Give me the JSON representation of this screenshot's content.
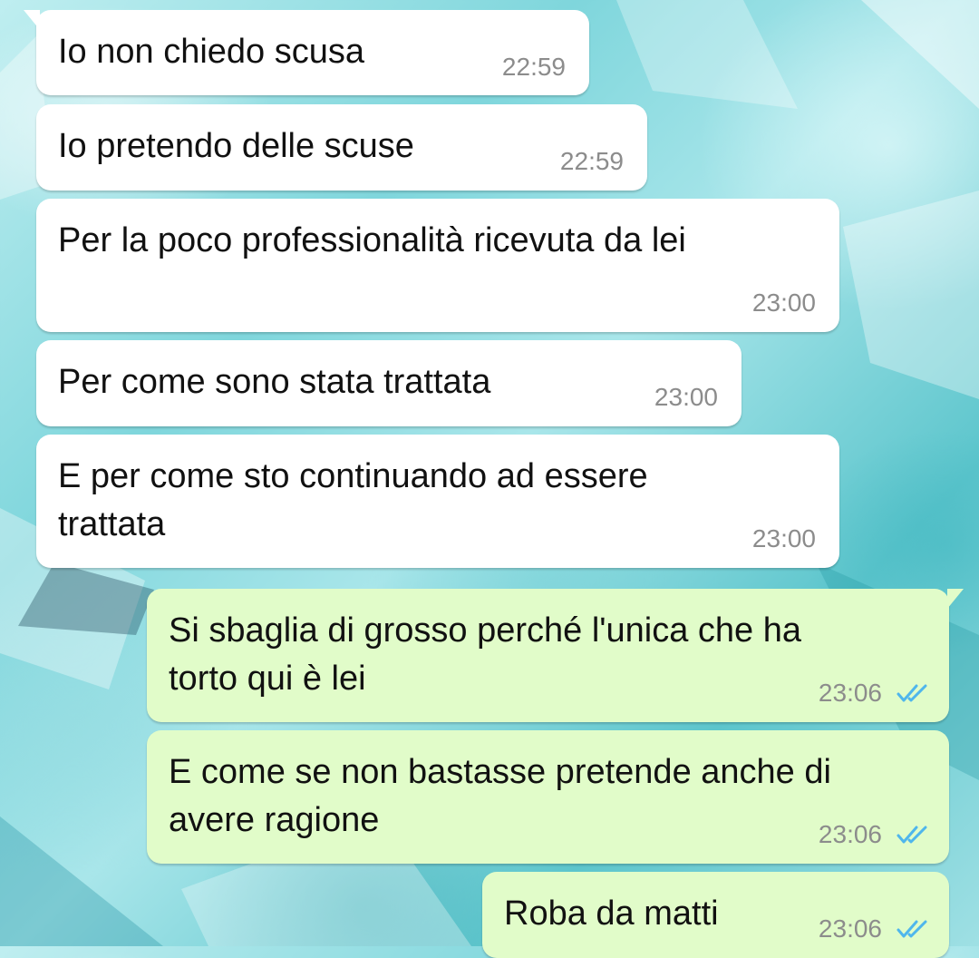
{
  "messages": [
    {
      "direction": "incoming",
      "text": "Io non chiedo scusa",
      "time": "22:59"
    },
    {
      "direction": "incoming",
      "text": "Io pretendo delle scuse",
      "time": "22:59"
    },
    {
      "direction": "incoming",
      "text": "Per la poco professionalità ricevuta da lei",
      "time": "23:00"
    },
    {
      "direction": "incoming",
      "text": "Per come sono stata trattata",
      "time": "23:00"
    },
    {
      "direction": "incoming",
      "line1": "E per come sto continuando ad essere",
      "line2": "trattata",
      "time": "23:00"
    },
    {
      "direction": "outgoing",
      "line1": "Si sbaglia di grosso perché l'unica che ha",
      "line2": "torto qui è lei",
      "time": "23:06",
      "status": "read",
      "status_icon": "double-check-icon"
    },
    {
      "direction": "outgoing",
      "line1": "E come se non bastasse pretende anche di",
      "line2": "avere ragione",
      "time": "23:06",
      "status": "read",
      "status_icon": "double-check-icon"
    },
    {
      "direction": "outgoing",
      "text": "Roba da matti",
      "time": "23:06",
      "status": "read",
      "status_icon": "double-check-icon"
    }
  ],
  "colors": {
    "incoming_bubble": "#ffffff",
    "outgoing_bubble": "#e1fcc9",
    "timestamp": "#8c8c8c",
    "read_ticks": "#4fb6ec",
    "wallpaper": "#7fd6dc"
  }
}
